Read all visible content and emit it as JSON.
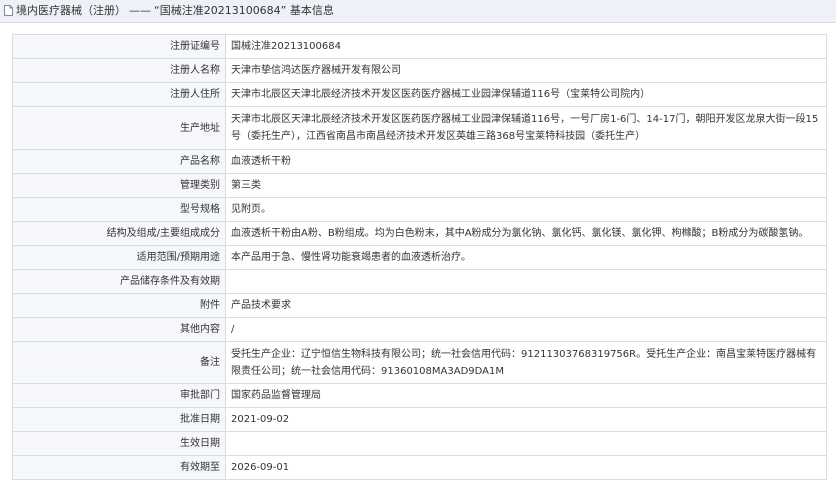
{
  "header": {
    "category": "境内医疗器械（注册）",
    "separator": "——",
    "title": "“国械注准20213100684” 基本信息"
  },
  "rows": [
    {
      "label": "注册证编号",
      "value": "国械注准20213100684"
    },
    {
      "label": "注册人名称",
      "value": "天津市挚信鸿达医疗器械开发有限公司"
    },
    {
      "label": "注册人住所",
      "value": "天津市北辰区天津北辰经济技术开发区医药医疗器械工业园津保辅道116号（宝莱特公司院内）"
    },
    {
      "label": "生产地址",
      "value": "天津市北辰区天津北辰经济技术开发区医药医疗器械工业园津保辅道116号，一号厂房1-6门、14-17门，朝阳开发区龙泉大街一段15号（委托生产），江西省南昌市南昌经济技术开发区英雄三路368号宝莱特科技园（委托生产）"
    },
    {
      "label": "产品名称",
      "value": "血液透析干粉"
    },
    {
      "label": "管理类别",
      "value": "第三类"
    },
    {
      "label": "型号规格",
      "value": "见附页。"
    },
    {
      "label": "结构及组成/主要组成成分",
      "value": "血液透析干粉由A粉、B粉组成。均为白色粉末，其中A粉成分为氯化钠、氯化钙、氯化镁、氯化钾、枸橼酸；B粉成分为碳酸氢钠。"
    },
    {
      "label": "适用范围/预期用途",
      "value": "本产品用于急、慢性肾功能衰竭患者的血液透析治疗。"
    },
    {
      "label": "产品储存条件及有效期",
      "value": ""
    },
    {
      "label": "附件",
      "value": "产品技术要求"
    },
    {
      "label": "其他内容",
      "value": "/"
    },
    {
      "label": "备注",
      "value": "受托生产企业：辽宁恒信生物科技有限公司；统一社会信用代码：91211303768319756R。受托生产企业：南昌宝莱特医疗器械有限责任公司；统一社会信用代码：91360108MA3AD9DA1M"
    },
    {
      "label": "审批部门",
      "value": "国家药品监督管理局"
    },
    {
      "label": "批准日期",
      "value": "2021-09-02"
    },
    {
      "label": "生效日期",
      "value": ""
    },
    {
      "label": "有效期至",
      "value": "2026-09-01"
    }
  ]
}
